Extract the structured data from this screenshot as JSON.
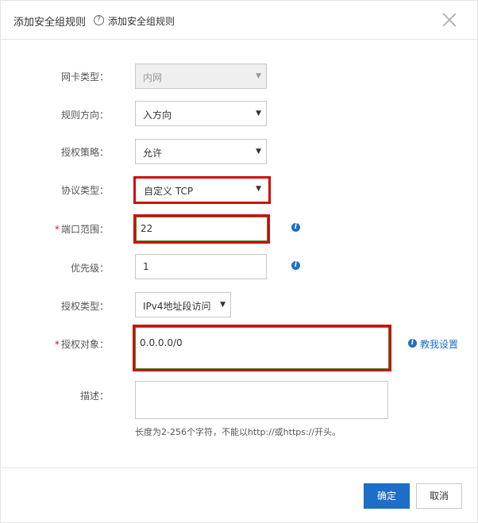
{
  "dialog": {
    "title": "添加安全组规则",
    "help_mark": "?",
    "subtitle": "添加安全组规则"
  },
  "form": {
    "nic_type": {
      "label": "网卡类型：",
      "value": "内网"
    },
    "direction": {
      "label": "规则方向：",
      "value": "入方向"
    },
    "policy": {
      "label": "授权策略：",
      "value": "允许"
    },
    "protocol": {
      "label": "协议类型：",
      "value": "自定义 TCP"
    },
    "port_range": {
      "required_mark": "*",
      "label": "端口范围：",
      "value": "22"
    },
    "priority": {
      "label": "优先级：",
      "value": "1"
    },
    "auth_type": {
      "label": "授权类型：",
      "value": "IPv4地址段访问"
    },
    "auth_object": {
      "required_mark": "*",
      "label": "授权对象：",
      "value": "0.0.0.0/0",
      "help_link": "教我设置"
    },
    "description": {
      "label": "描述：",
      "value": "",
      "hint": "长度为2-256个字符，不能以http://或https://开头。"
    }
  },
  "footer": {
    "confirm_label": "确定",
    "cancel_label": "取消"
  },
  "colors": {
    "primary": "#1b6fc7",
    "highlight": "#d20a0a",
    "required": "#e0102b"
  }
}
